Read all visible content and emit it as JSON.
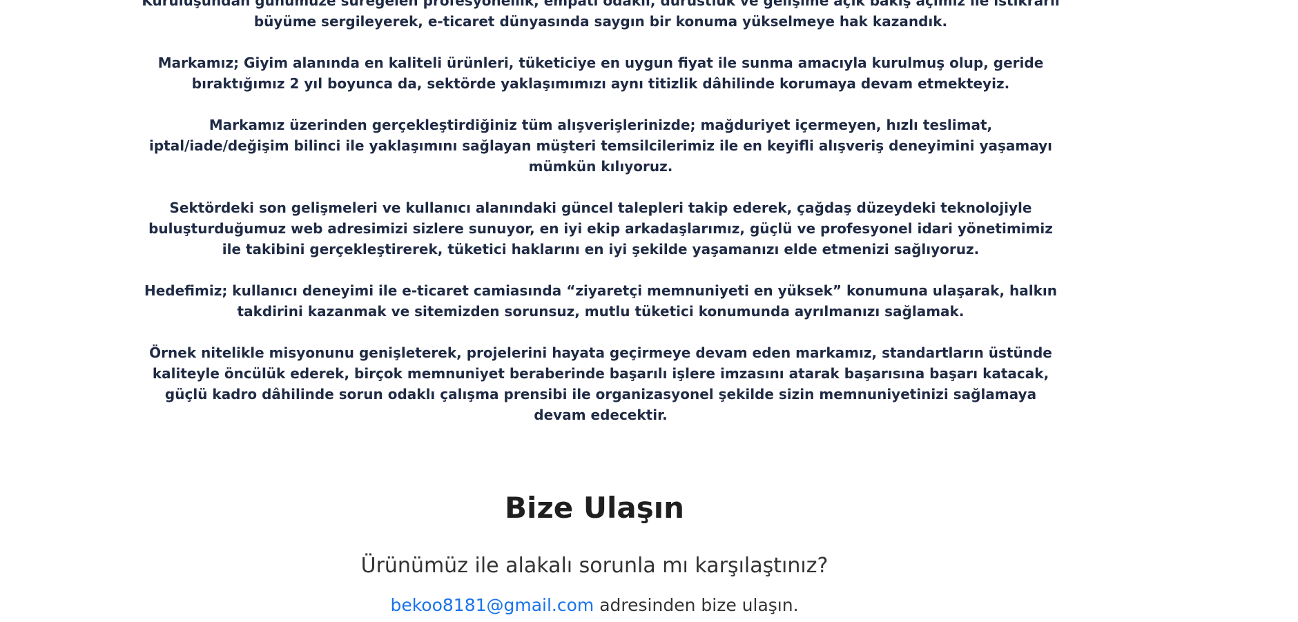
{
  "about": {
    "paragraphs": [
      "Kuruluşundan günümüze süregelen profesyonellik, empati odaklı, dürüstlük ve gelişime açık bakış açımız ile istikrarlı büyüme sergileyerek, e-ticaret dünyasında saygın bir konuma yükselmeye hak kazandık.",
      "Markamız; Giyim alanında en kaliteli ürünleri, tüketiciye en uygun fiyat ile sunma amacıyla kurulmuş olup, geride bıraktığımız 2 yıl boyunca da, sektörde yaklaşımımızı aynı titizlik dâhilinde korumaya devam etmekteyiz.",
      "Markamız üzerinden gerçekleştirdiğiniz tüm alışverişlerinizde; mağduriyet içermeyen, hızlı teslimat, iptal/iade/değişim bilinci ile yaklaşımını sağlayan müşteri temsilcilerimiz ile en keyifli alışveriş deneyimini yaşamayı mümkün kılıyoruz.",
      "Sektördeki son gelişmeleri ve kullanıcı alanındaki güncel talepleri takip ederek, çağdaş düzeydeki teknolojiyle buluşturduğumuz web adresimizi sizlere sunuyor, en iyi ekip arkadaşlarımız, güçlü ve profesyonel idari yönetimimiz ile takibini gerçekleştirerek, tüketici haklarını en iyi şekilde yaşamanızı elde etmenizi sağlıyoruz.",
      "Hedefimiz; kullanıcı deneyimi ile e-ticaret camiasında “ziyaretçi memnuniyeti en yüksek” konumuna ulaşarak, halkın takdirini kazanmak ve sitemizden sorunsuz, mutlu tüketici konumunda ayrılmanızı sağlamak.",
      "Örnek nitelikle misyonunu genişleterek, projelerini hayata geçirmeye devam eden markamız, standartların üstünde kaliteyle öncülük ederek, birçok memnuniyet beraberinde başarılı işlere imzasını atarak başarısına başarı katacak, güçlü kadro dâhilinde sorun odaklı çalışma prensibi ile organizasyonel şekilde sizin memnuniyetinizi sağlamaya devam edecektir."
    ]
  },
  "contact": {
    "title": "Bize Ulaşın",
    "subtitle": "Ürünümüz ile alakalı sorunla mı karşılaştınız?",
    "email": "bekoo8181@gmail.com",
    "email_suffix": " adresinden bize ulaşın."
  },
  "colors": {
    "body_text": "#1f2a44",
    "link": "#1a73e8",
    "heading": "#1f1f1f"
  }
}
